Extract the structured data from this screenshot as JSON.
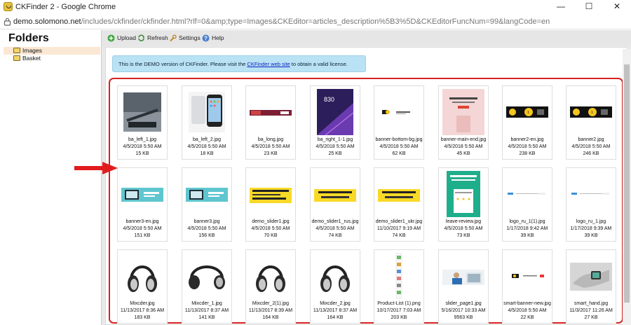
{
  "window": {
    "title": "CKFinder 2 - Google Chrome",
    "minimize": "—",
    "maximize": "☐",
    "close": "✕"
  },
  "address": {
    "host": "demo.solomono.net",
    "path": "/includes/ckfinder/ckfinder.html?rlf=0&amp;type=Images&CKEditor=articles_description%5B3%5D&CKEditorFuncNum=99&langCode=en"
  },
  "sidebar": {
    "title": "Folders",
    "folders": [
      {
        "label": "Images",
        "selected": true
      },
      {
        "label": "Basket",
        "selected": false
      }
    ]
  },
  "toolbar": {
    "upload": "Upload",
    "refresh": "Refresh",
    "settings": "Settings",
    "help": "Help"
  },
  "demo": {
    "before": "This is the DEMO version of CKFinder. Please visit the",
    "link": "CKFinder web site",
    "after": "to obtain a valid license."
  },
  "files": [
    {
      "name": "ba_left_1.jpg",
      "date": "4/5/2018 5:50 AM",
      "size": "15 KB",
      "thumb": "laptop"
    },
    {
      "name": "ba_left_2.jpg",
      "date": "4/5/2018 5:50 AM",
      "size": "18 KB",
      "thumb": "phone"
    },
    {
      "name": "ba_long.jpg",
      "date": "4/5/2018 5:50 AM",
      "size": "23 KB",
      "thumb": "long"
    },
    {
      "name": "ba_right_1-1.jpg",
      "date": "4/5/2018 5:50 AM",
      "size": "25 KB",
      "thumb": "purple"
    },
    {
      "name": "banner-bottom-bg.jpg",
      "date": "4/5/2018 5:50 AM",
      "size": "62 KB",
      "thumb": "bannerbottom"
    },
    {
      "name": "banner-main-end.jpg",
      "date": "4/5/2018 5:50 AM",
      "size": "45 KB",
      "thumb": "pink"
    },
    {
      "name": "banner2-en.jpg",
      "date": "4/5/2018 5:50 AM",
      "size": "238 KB",
      "thumb": "black"
    },
    {
      "name": "banner2.jpg",
      "date": "4/5/2018 5:50 AM",
      "size": "246 KB",
      "thumb": "black"
    },
    {
      "name": "banner3-en.jpg",
      "date": "4/5/2018 5:50 AM",
      "size": "151 KB",
      "thumb": "teal"
    },
    {
      "name": "banner3.jpg",
      "date": "4/5/2018 5:50 AM",
      "size": "156 KB",
      "thumb": "teal"
    },
    {
      "name": "demo_slider1.jpg",
      "date": "4/5/2018 5:50 AM",
      "size": "70 KB",
      "thumb": "yellow"
    },
    {
      "name": "demo_slider1_rus.jpg",
      "date": "4/5/2018 5:50 AM",
      "size": "74 KB",
      "thumb": "yellowdark"
    },
    {
      "name": "demo_slider1_ukr.jpg",
      "date": "11/10/2017 9:19 AM",
      "size": "74 KB",
      "thumb": "yellowdark"
    },
    {
      "name": "leave-review.jpg",
      "date": "4/5/2018 5:50 AM",
      "size": "73 KB",
      "thumb": "review"
    },
    {
      "name": "logo_ru_1(1).jpg",
      "date": "1/17/2018 9:42 AM",
      "size": "39 KB",
      "thumb": "logo"
    },
    {
      "name": "logo_ru_1.jpg",
      "date": "1/17/2018 9:39 AM",
      "size": "39 KB",
      "thumb": "logo"
    },
    {
      "name": "Mixcder.jpg",
      "date": "11/13/2017 8:36 AM",
      "size": "183 KB",
      "thumb": "headphone"
    },
    {
      "name": "Mixcder_1.jpg",
      "date": "11/13/2017 8:37 AM",
      "size": "141 KB",
      "thumb": "headphonewide"
    },
    {
      "name": "Mixcder_2(1).jpg",
      "date": "11/13/2017 8:39 AM",
      "size": "164 KB",
      "thumb": "headphone"
    },
    {
      "name": "Mixcder_2.jpg",
      "date": "11/13/2017 8:37 AM",
      "size": "164 KB",
      "thumb": "headphone"
    },
    {
      "name": "Product-List (1).png",
      "date": "10/17/2017 7:03 AM",
      "size": "203 KB",
      "thumb": "productlist"
    },
    {
      "name": "slider_page1.jpg",
      "date": "5/16/2017 10:33 AM",
      "size": "9563 KB",
      "thumb": "slider"
    },
    {
      "name": "smart-banner-new.jpg",
      "date": "4/5/2018 5:50 AM",
      "size": "22 KB",
      "thumb": "smartbanner"
    },
    {
      "name": "smart_hand.jpg",
      "date": "11/3/2017 11:26 AM",
      "size": "27 KB",
      "thumb": "hand"
    }
  ]
}
